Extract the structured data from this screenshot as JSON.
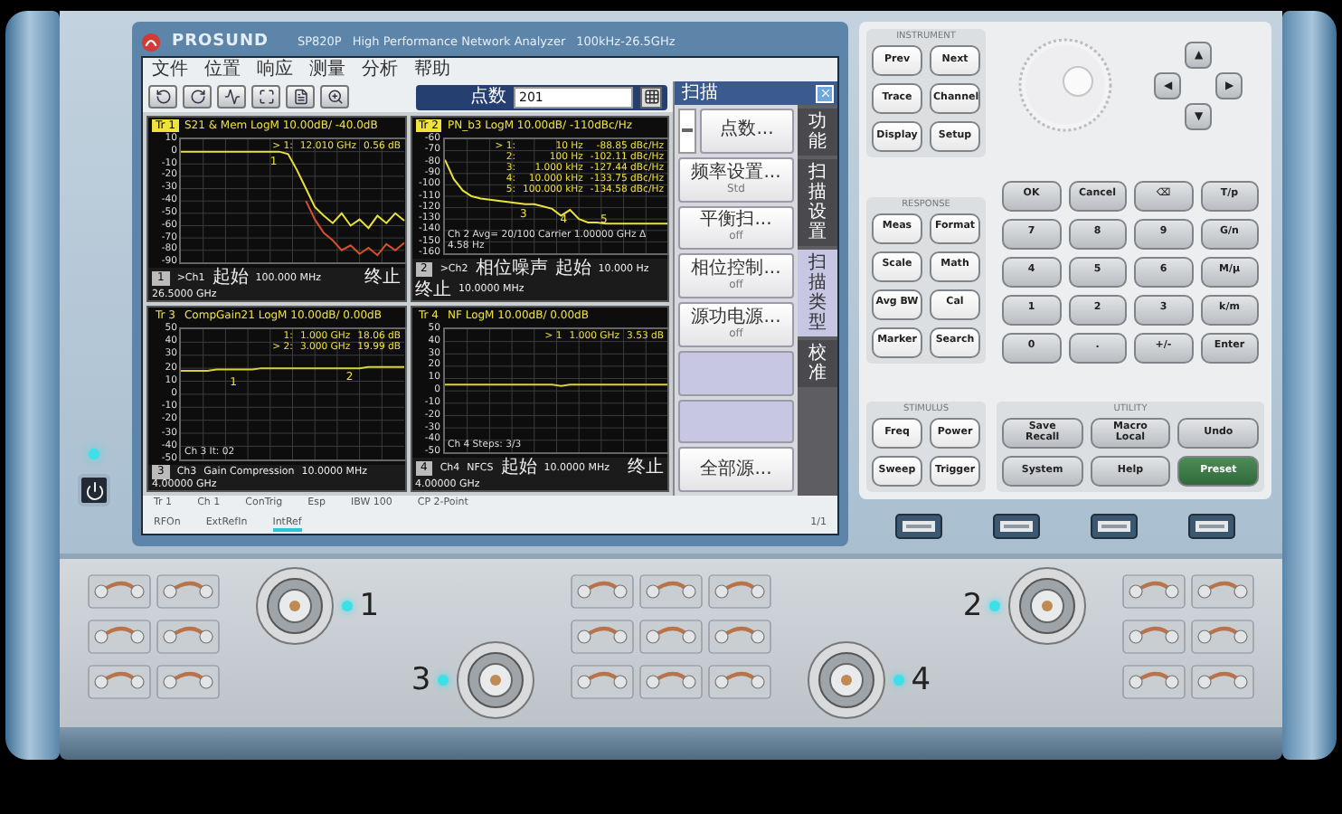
{
  "title_bar": {
    "brand": "PROSUND",
    "model": "SP820P",
    "description": "High Performance Network Analyzer",
    "range": "100kHz-26.5GHz"
  },
  "menu": [
    "文件",
    "位置",
    "响应",
    "测量",
    "分析",
    "帮助"
  ],
  "points": {
    "label": "点数",
    "value": "201"
  },
  "charts": [
    {
      "kind": "lowpass",
      "trace": "Tr 1",
      "active": true,
      "header": "S21 & Mem LogM 10.00dB/ -40.0dB",
      "markers": [
        {
          "name": "> 1:",
          "x": "12.010 GHz",
          "y": "0.56 dB"
        }
      ],
      "chart_data": {
        "type": "line",
        "grid": true,
        "ylim": [
          -90,
          10
        ],
        "yticks": [
          10,
          0,
          -10,
          -20,
          -30,
          -40,
          -50,
          -60,
          -70,
          -80,
          -90
        ],
        "series": [
          {
            "color": "#e8e23a",
            "values": [
              0,
              0,
              0,
              0,
              0,
              0,
              0,
              0,
              0,
              0,
              0,
              0,
              -2,
              -15,
              -30,
              -45,
              -52,
              -58,
              -50,
              -60,
              -55,
              -62,
              -52,
              -58,
              -50,
              -56
            ]
          },
          {
            "color": "#d8502a",
            "values": [
              null,
              null,
              null,
              null,
              null,
              null,
              null,
              null,
              null,
              null,
              null,
              null,
              null,
              null,
              -40,
              -55,
              -66,
              -72,
              -80,
              -76,
              -83,
              -78,
              -84,
              -75,
              -80,
              -74
            ]
          }
        ]
      },
      "plot_labels": [
        "1"
      ],
      "footer": {
        "number": "1",
        "start": [
          ">Ch1",
          "起始",
          "100.000 MHz"
        ],
        "stop": [
          "终止",
          "26.5000 GHz"
        ]
      }
    },
    {
      "kind": "phase_noise",
      "trace": "Tr 2",
      "active": true,
      "header": "PN_b3 LogM 10.00dB/ -110dBc/Hz",
      "markers": [
        {
          "name": "> 1:",
          "x": "10 Hz",
          "y": "-88.85 dBc/Hz"
        },
        {
          "name": "2:",
          "x": "100 Hz",
          "y": "-102.11 dBc/Hz"
        },
        {
          "name": "3:",
          "x": "1.000 kHz",
          "y": "-127.44 dBc/Hz"
        },
        {
          "name": "4:",
          "x": "10.000 kHz",
          "y": "-133.75 dBc/Hz"
        },
        {
          "name": "5:",
          "x": "100.000 kHz",
          "y": "-134.58 dBc/Hz"
        }
      ],
      "chart_data": {
        "type": "line",
        "grid": true,
        "ylim": [
          -160,
          -60
        ],
        "yticks": [
          -60,
          -70,
          -80,
          -90,
          -100,
          -110,
          -120,
          -130,
          -140,
          -150,
          -160
        ],
        "series": [
          {
            "color": "#e8e23a",
            "values": [
              -78,
              -95,
              -105,
              -110,
              -112,
              -113,
              -114,
              -115,
              -116,
              -117,
              -117,
              -119,
              -121,
              -127,
              -122,
              -130,
              -133,
              -133,
              -134,
              -134,
              -134,
              -134,
              -134,
              -134,
              -134,
              -134
            ]
          }
        ]
      },
      "status": "Ch 2 Avg= 20/100  Carrier 1.00000 GHz  Δ 4.58 Hz",
      "plot_labels": [
        "3",
        "4",
        "5"
      ],
      "footer": {
        "number": "2",
        "start": [
          ">Ch2",
          "相位噪声",
          "起始",
          "10.000 Hz"
        ],
        "stop": [
          "终止",
          "10.0000 MHz"
        ]
      }
    },
    {
      "kind": "gain",
      "trace": "Tr 3",
      "active": false,
      "header": "CompGain21 LogM 10.00dB/ 0.00dB",
      "markers": [
        {
          "name": "1:",
          "x": "1.000 GHz",
          "y": "18.06 dB"
        },
        {
          "name": "> 2:",
          "x": "3.000 GHz",
          "y": "19.99 dB"
        }
      ],
      "chart_data": {
        "type": "line",
        "grid": true,
        "ylim": [
          -50,
          50
        ],
        "yticks": [
          50,
          40,
          30,
          20,
          10,
          0,
          -10,
          -20,
          -30,
          -40,
          -50
        ],
        "series": [
          {
            "color": "#d8d23a",
            "values": [
              18,
              18,
              18,
              18,
              19,
              19,
              19,
              19,
              19,
              20,
              20,
              20,
              20,
              20,
              20,
              20,
              20,
              20,
              20,
              20,
              20,
              21,
              21,
              21,
              21,
              21
            ]
          }
        ]
      },
      "status": "Ch 3  It: 02",
      "plot_labels": [
        "1",
        "2"
      ],
      "footer": {
        "number": "3",
        "start": [
          "Ch3",
          "Gain Compression",
          "10.0000 MHz"
        ],
        "stop": [
          "4.00000 GHz"
        ]
      }
    },
    {
      "kind": "noise_figure",
      "trace": "Tr 4",
      "active": false,
      "header": "NF LogM 10.00dB/ 0.00dB",
      "markers": [
        {
          "name": "> 1",
          "x": "1.000 GHz",
          "y": "3.53 dB"
        }
      ],
      "chart_data": {
        "type": "line",
        "grid": true,
        "ylim": [
          -50,
          50
        ],
        "yticks": [
          50,
          40,
          30,
          20,
          10,
          0,
          -10,
          -20,
          -30,
          -40,
          -50
        ],
        "series": [
          {
            "color": "#d8d23a",
            "values": [
              5,
              5,
              5,
              5,
              5,
              5,
              5,
              5,
              5,
              5,
              5,
              5,
              5,
              4,
              5,
              5,
              5,
              5,
              5,
              5,
              5,
              5,
              5,
              5,
              5,
              5
            ]
          }
        ]
      },
      "status": "Ch 4  Steps: 3/3",
      "footer": {
        "number": "4",
        "start": [
          "Ch4",
          "NFCS",
          "起始",
          "10.0000 MHz"
        ],
        "stop": [
          "终止",
          "4.00000 GHz"
        ]
      }
    }
  ],
  "softpanel": {
    "title": "扫描",
    "keys": [
      {
        "kind": "toggle",
        "label": "点数..."
      },
      {
        "kind": "key",
        "label": "频率设置...",
        "value": "Std"
      },
      {
        "kind": "key",
        "label": "平衡扫...",
        "value": "off"
      },
      {
        "kind": "key",
        "label": "相位控制...",
        "value": "off"
      },
      {
        "kind": "key",
        "label": "源功电源...",
        "value": "off"
      },
      {
        "kind": "blank"
      },
      {
        "kind": "blank"
      },
      {
        "kind": "key",
        "label": "全部源..."
      }
    ],
    "tabs": [
      {
        "label": "功能",
        "selected": false
      },
      {
        "label": "扫描设置",
        "selected": false
      },
      {
        "label": "扫描类型",
        "selected": true
      },
      {
        "label": "校准",
        "selected": false
      }
    ]
  },
  "status_bar": {
    "row1": [
      {
        "text": "Tr 1",
        "highlighted": false
      },
      {
        "text": "Ch 1",
        "highlighted": false
      },
      {
        "text": "ConTrig",
        "highlighted": false
      },
      {
        "text": "Esp",
        "highlighted": false
      },
      {
        "text": "IBW 100",
        "highlighted": false
      },
      {
        "text": "CP 2-Point",
        "highlighted": false
      }
    ],
    "row2": [
      {
        "text": "RFOn",
        "highlighted": false
      },
      {
        "text": "ExtRefIn",
        "highlighted": false
      },
      {
        "text": "IntRef",
        "highlighted": true
      }
    ],
    "page": "1/1"
  },
  "keypad": {
    "instrument": {
      "title": "INSTRUMENT",
      "keys": [
        {
          "label": "Prev",
          "kind": "function"
        },
        {
          "label": "Next",
          "kind": "function"
        },
        {
          "label": "Trace",
          "kind": "function"
        },
        {
          "label": "Channel",
          "kind": "function"
        },
        {
          "label": "Display",
          "kind": "function"
        },
        {
          "label": "Setup",
          "kind": "function"
        }
      ]
    },
    "response": {
      "title": "RESPONSE",
      "keys": [
        {
          "label": "Meas",
          "kind": "function"
        },
        {
          "label": "Format",
          "kind": "function"
        },
        {
          "label": "Scale",
          "kind": "function"
        },
        {
          "label": "Math",
          "kind": "function"
        },
        {
          "label": "Avg BW",
          "kind": "function"
        },
        {
          "label": "Cal",
          "kind": "function"
        },
        {
          "label": "Marker",
          "kind": "function"
        },
        {
          "label": "Search",
          "kind": "function"
        }
      ]
    },
    "stimulus": {
      "title": "STIMULUS",
      "keys": [
        {
          "label": "Freq",
          "kind": "function"
        },
        {
          "label": "Power",
          "kind": "function"
        },
        {
          "label": "Sweep",
          "kind": "function"
        },
        {
          "label": "Trigger",
          "kind": "function"
        }
      ]
    },
    "arrows": [
      "▲",
      "◀",
      "▶",
      "▼"
    ],
    "numpad": [
      {
        "label": "OK",
        "kind": "entry"
      },
      {
        "label": "Cancel",
        "kind": "entry"
      },
      {
        "label": "⌫",
        "kind": "entry"
      },
      {
        "label": "T/p",
        "kind": "entry"
      },
      {
        "label": "7",
        "kind": "entry"
      },
      {
        "label": "8",
        "kind": "entry"
      },
      {
        "label": "9",
        "kind": "entry"
      },
      {
        "label": "G/n",
        "kind": "entry"
      },
      {
        "label": "4",
        "kind": "entry"
      },
      {
        "label": "5",
        "kind": "entry"
      },
      {
        "label": "6",
        "kind": "entry"
      },
      {
        "label": "M/μ",
        "kind": "entry"
      },
      {
        "label": "1",
        "kind": "entry"
      },
      {
        "label": "2",
        "kind": "entry"
      },
      {
        "label": "3",
        "kind": "entry"
      },
      {
        "label": "k/m",
        "kind": "entry"
      },
      {
        "label": "0",
        "kind": "entry"
      },
      {
        "label": ".",
        "kind": "entry"
      },
      {
        "label": "+/-",
        "kind": "entry"
      },
      {
        "label": "Enter",
        "kind": "entry"
      }
    ],
    "utility": {
      "title": "UTILITY",
      "keys": [
        {
          "label": "Save\nRecall",
          "kind": "entry"
        },
        {
          "label": "Macro\nLocal",
          "kind": "entry"
        },
        {
          "label": "Undo",
          "kind": "entry"
        },
        {
          "label": "System",
          "kind": "entry"
        },
        {
          "label": "Help",
          "kind": "entry"
        },
        {
          "label": "Preset",
          "kind": "preset"
        }
      ]
    }
  },
  "ports": [
    {
      "label": "1"
    },
    {
      "label": "3"
    },
    {
      "label": "4"
    },
    {
      "label": "2"
    }
  ]
}
